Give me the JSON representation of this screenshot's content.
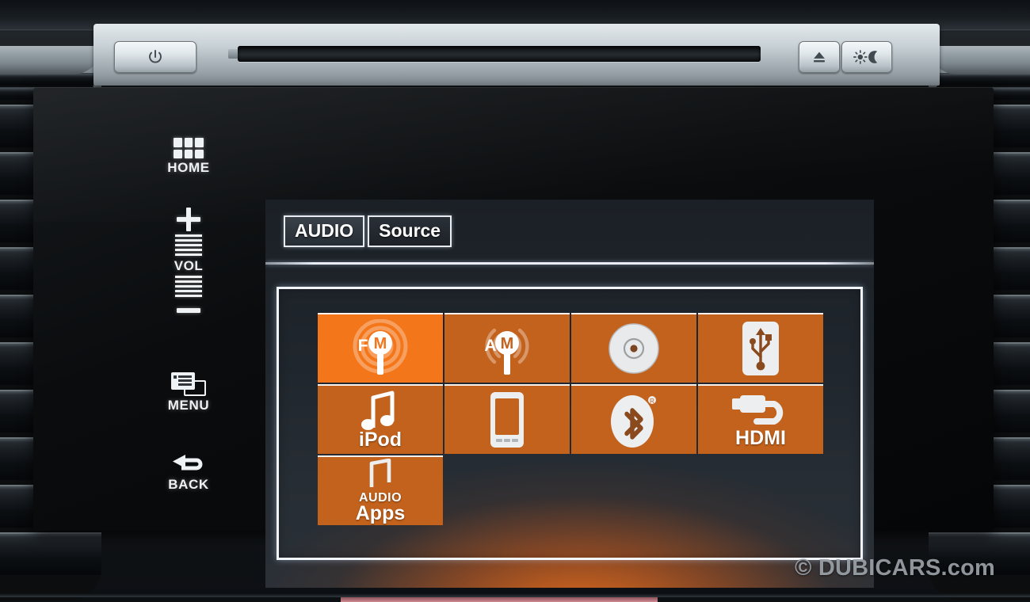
{
  "hardware": {
    "power_button": {
      "name": "power-button",
      "glyph": "⏻"
    },
    "eject_button": {
      "name": "eject-button",
      "glyph": "⏏"
    },
    "display_button": {
      "name": "display-brightness-button",
      "glyph": "☀☾"
    },
    "cd_slot_label": "CD slot"
  },
  "sidebar": {
    "items": [
      {
        "label": "HOME",
        "icon": "home-grid-icon"
      },
      {
        "label": "VOL",
        "icon": "volume-slider-icon",
        "plus": "+",
        "minus": "−"
      },
      {
        "label": "MENU",
        "icon": "menu-windows-icon"
      },
      {
        "label": "BACK",
        "icon": "back-arrow-icon"
      }
    ]
  },
  "screen": {
    "tabs": [
      {
        "label": "AUDIO",
        "active": true
      },
      {
        "label": "Source",
        "active": false
      }
    ],
    "sources": [
      {
        "label": "FM",
        "icon": "fm-radio-tower-icon",
        "selected": true,
        "show_label": false
      },
      {
        "label": "AM",
        "icon": "am-radio-tower-icon",
        "selected": false,
        "show_label": false
      },
      {
        "label": "CD",
        "icon": "cd-disc-icon",
        "selected": false,
        "show_label": false
      },
      {
        "label": "USB",
        "icon": "usb-icon",
        "selected": false,
        "show_label": false
      },
      {
        "label": "iPod",
        "icon": "music-note-icon",
        "selected": false,
        "show_label": true
      },
      {
        "label": "Phone",
        "icon": "smartphone-icon",
        "selected": false,
        "show_label": false
      },
      {
        "label": "Bluetooth",
        "icon": "bluetooth-icon",
        "selected": false,
        "show_label": false
      },
      {
        "label": "HDMI",
        "icon": "hdmi-cable-icon",
        "selected": false,
        "show_label": true
      },
      {
        "label": "Apps",
        "label_top": "AUDIO",
        "icon": "audio-apps-note-icon",
        "selected": false,
        "show_label": true
      }
    ]
  },
  "watermark": {
    "text": "© DUBICARS.com"
  },
  "colors": {
    "tile_selected": "#f4761a",
    "tile_default": "#c3621c",
    "screen_bg": "#232a31",
    "accent_white": "#f1f4f8"
  }
}
